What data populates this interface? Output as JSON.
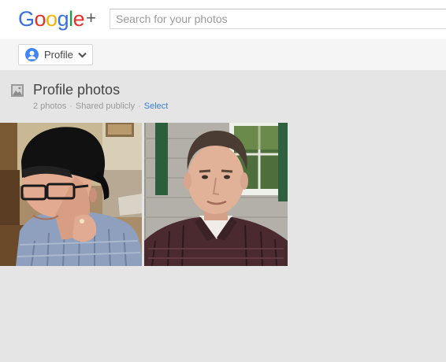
{
  "header": {
    "logo": {
      "letters": [
        "G",
        "o",
        "o",
        "g",
        "l",
        "e"
      ],
      "plus": "+"
    },
    "search": {
      "placeholder": "Search for your photos",
      "value": ""
    }
  },
  "subnav": {
    "profile_label": "Profile"
  },
  "album": {
    "title": "Profile photos",
    "count": "2 photos",
    "visibility": "Shared publicly",
    "separator": "·",
    "select_label": "Select"
  },
  "colors": {
    "google_blue": "#3a6fe0",
    "google_red": "#e2322b",
    "google_yellow": "#f4b400",
    "google_green": "#1da046",
    "link_blue": "#3b7ddd",
    "page_bg": "#e5e5e5"
  },
  "icons": {
    "avatar": "person-avatar-icon",
    "chevron": "chevron-down-icon",
    "album": "photo-album-icon"
  }
}
